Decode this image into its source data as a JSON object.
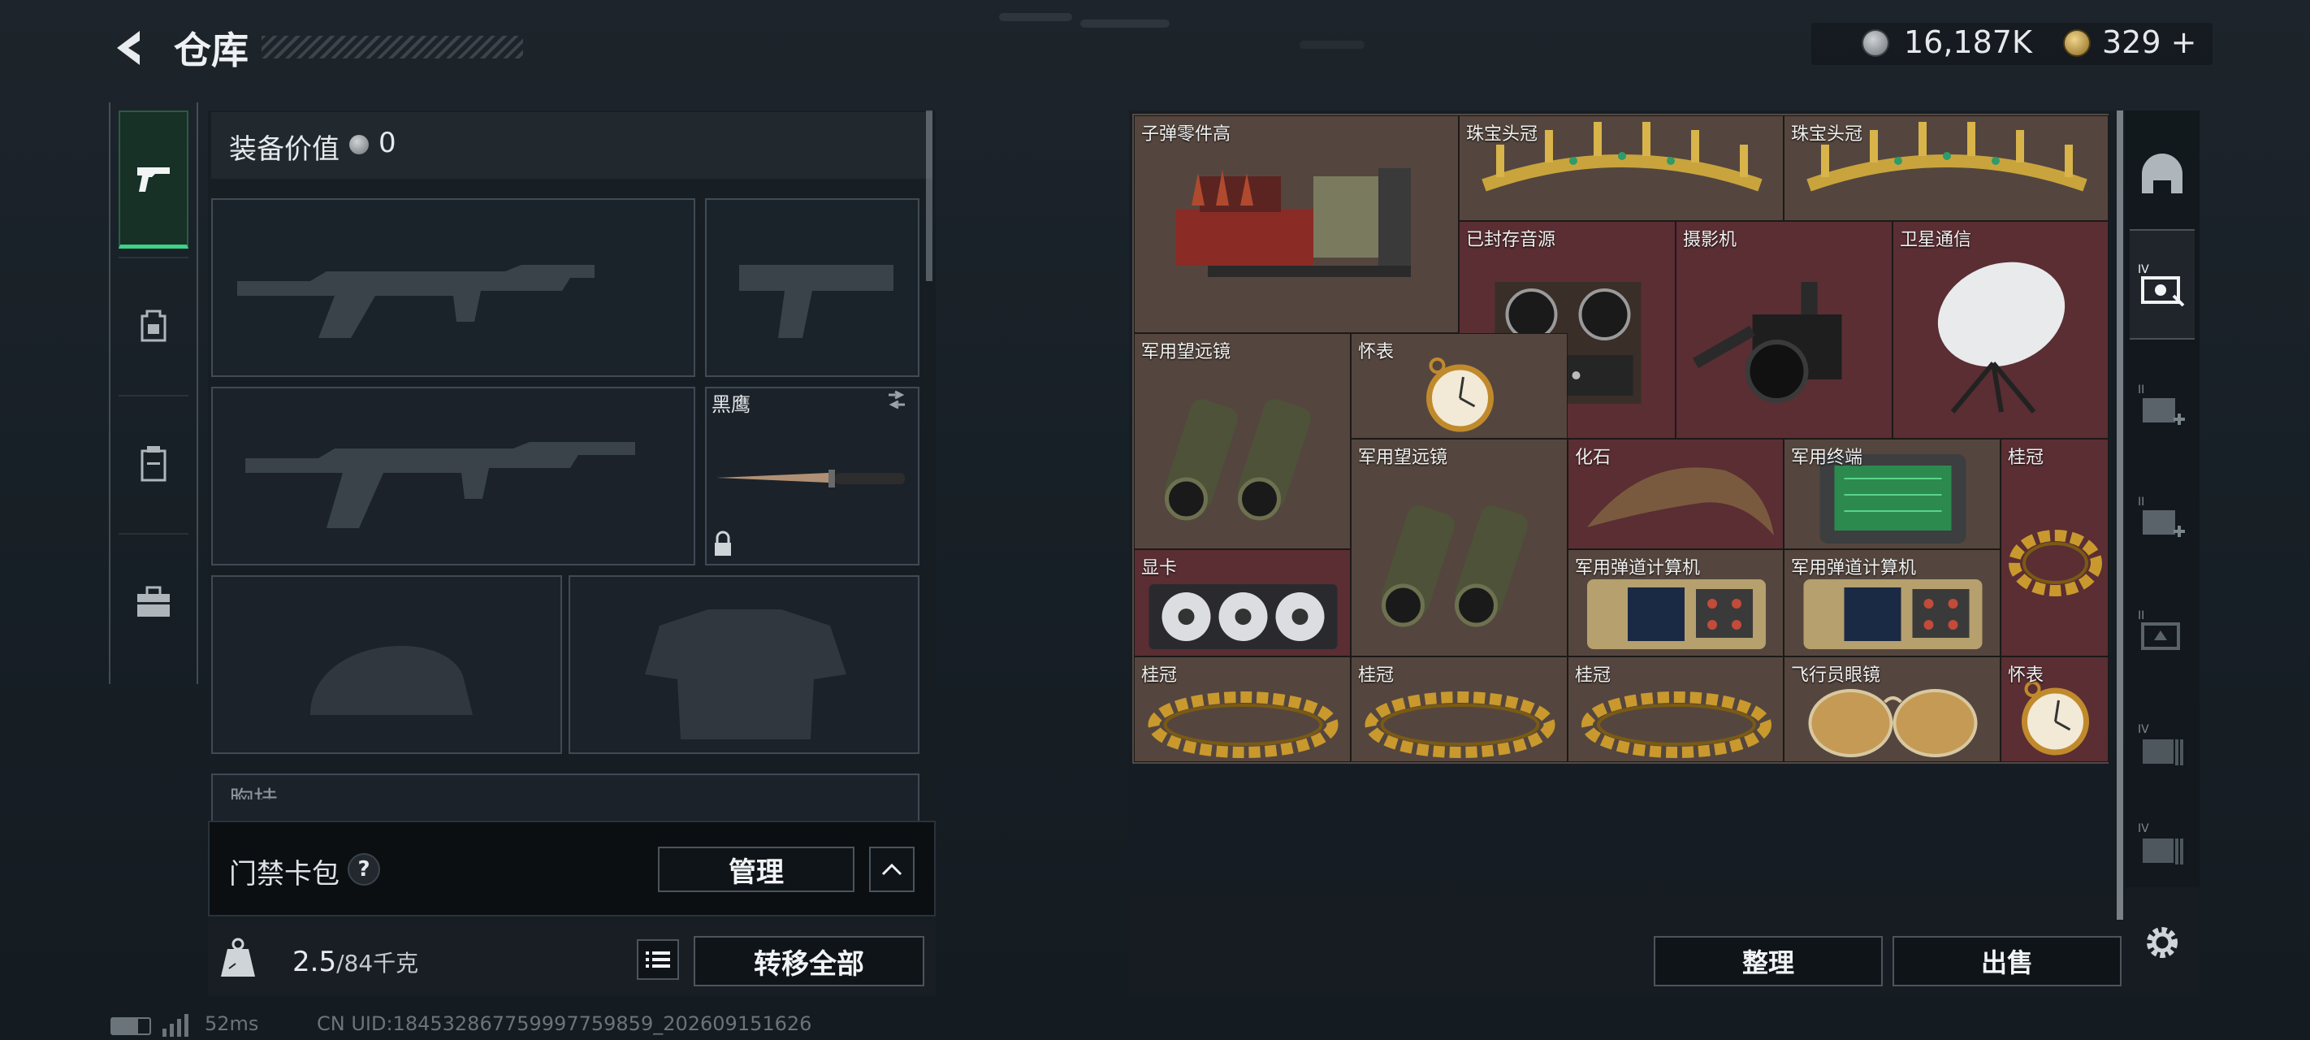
{
  "header": {
    "title": "仓库",
    "currency_silver": "16,187K",
    "currency_gold": "329",
    "currency_add": "+"
  },
  "left_tabs": [
    "pistol-icon",
    "backpack-icon",
    "rig-icon",
    "toolbox-icon"
  ],
  "equipment": {
    "value_label": "装备价值",
    "value": "0",
    "knife_name": "黑鹰",
    "chest_rig_label": "胸挂"
  },
  "keycard": {
    "label": "门禁卡包",
    "help": "?",
    "manage_label": "管理"
  },
  "weight": {
    "current": "2.5",
    "max": "/84千克",
    "transfer_label": "转移全部"
  },
  "stash": {
    "items": [
      {
        "name": "子弹零件高",
        "bg": "#54463e",
        "icon": "ammo-parts-crate"
      },
      {
        "name": "珠宝头冠",
        "bg": "#54463e",
        "icon": "tiara"
      },
      {
        "name": "珠宝头冠",
        "bg": "#54463e",
        "icon": "tiara"
      },
      {
        "name": "已封存音源",
        "bg": "#5a2e33",
        "icon": "reel-recorder"
      },
      {
        "name": "摄影机",
        "bg": "#5a2e33",
        "icon": "camera"
      },
      {
        "name": "卫星通信",
        "bg": "#5a2e33",
        "icon": "satellite-dish"
      },
      {
        "name": "军用望远镜",
        "bg": "#54463e",
        "icon": "binoculars"
      },
      {
        "name": "怀表",
        "bg": "#54463e",
        "icon": "pocket-watch"
      },
      {
        "name": "军用望远镜",
        "bg": "#54463e",
        "icon": "binoculars"
      },
      {
        "name": "化石",
        "bg": "#5a2e33",
        "icon": "fossil-claw"
      },
      {
        "name": "军用终端",
        "bg": "#54463e",
        "icon": "military-terminal"
      },
      {
        "name": "桂冠",
        "bg": "#5a2e33",
        "icon": "laurel-crown"
      },
      {
        "name": "显卡",
        "bg": "#5a2e33",
        "icon": "graphics-card"
      },
      {
        "name": "军用弹道计算机",
        "bg": "#54463e",
        "icon": "ballistic-computer"
      },
      {
        "name": "军用弹道计算机",
        "bg": "#54463e",
        "icon": "ballistic-computer"
      },
      {
        "name": "桂冠",
        "bg": "#54463e",
        "icon": "laurel-crown"
      },
      {
        "name": "桂冠",
        "bg": "#54463e",
        "icon": "laurel-crown"
      },
      {
        "name": "桂冠",
        "bg": "#54463e",
        "icon": "laurel-crown"
      },
      {
        "name": "飞行员眼镜",
        "bg": "#54463e",
        "icon": "aviator-glasses"
      },
      {
        "name": "怀表",
        "bg": "#5a2e33",
        "icon": "pocket-watch"
      }
    ],
    "sort_label": "整理",
    "sell_label": "出售"
  },
  "right_tabs": [
    "helmet-icon",
    "tier-iv-case-icon",
    "tier-ii-medkit-icon",
    "tier-ii-medkit-icon",
    "tier-ii-case-icon",
    "tier-iv-folder-icon",
    "tier-iv-folder-icon"
  ],
  "status": {
    "ping": "52ms",
    "uid": "CN UID:184532867759997759859_202609151626"
  },
  "colors": {
    "accent_green": "#3fd08a",
    "item_brown": "#54463e",
    "item_red": "#5a2e33"
  }
}
